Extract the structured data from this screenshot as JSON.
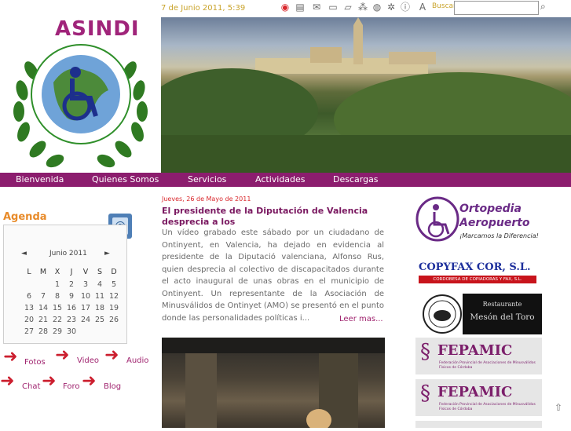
{
  "header": {
    "logo_text": "ASINDI",
    "logo_ring_text": "Asociación Integradora de Discapacitados",
    "date": "7 de Junio 2011, 5:39",
    "search_label": "Buscar",
    "search_value": ""
  },
  "nav": {
    "items": [
      {
        "label": "Bienvenida"
      },
      {
        "label": "Quienes Somos"
      },
      {
        "label": "Servicios"
      },
      {
        "label": "Actividades"
      },
      {
        "label": "Descargas"
      }
    ]
  },
  "agenda": {
    "title": "Agenda",
    "month": "Junio 2011",
    "prev": "◄",
    "next": "►",
    "weekdays": [
      "L",
      "M",
      "X",
      "J",
      "V",
      "S",
      "D"
    ],
    "weeks": [
      [
        "",
        "",
        "1",
        "2",
        "3",
        "4",
        "5"
      ],
      [
        "6",
        "7",
        "8",
        "9",
        "10",
        "11",
        "12"
      ],
      [
        "13",
        "14",
        "15",
        "16",
        "17",
        "18",
        "19"
      ],
      [
        "20",
        "21",
        "22",
        "23",
        "24",
        "25",
        "26"
      ],
      [
        "27",
        "28",
        "29",
        "30",
        "",
        "",
        ""
      ]
    ]
  },
  "links": {
    "fotos": "Fotos",
    "video": "Video",
    "audio": "Audio",
    "chat": "Chat",
    "foro": "Foro",
    "blog": "Blog"
  },
  "article": {
    "date": "Jueves, 26 de Mayo de 2011",
    "title": "El presidente de la Diputación de Valencia desprecia a los",
    "body": "Un vídeo grabado este sábado por un ciudadano de Ontinyent, en Valencia, ha dejado en evidencia al presidente de la Diputació valenciana, Alfonso Rus, quien desprecia al colectivo de discapacitados durante el acto inaugural de unas obras en el municipio de Ontinyent. Un representante de la Asociación de Minusválidos de Ontinyet (AMO)  se presentó en el punto donde las personalidades políticas i...",
    "read_more": "Leer mas..."
  },
  "ads": {
    "ortopedia_line1": "Ortopedia",
    "ortopedia_line2": "Aeropuerto",
    "ortopedia_tag": "¡Marcamos la Diferencia!",
    "copyfax_name": "COPYFAX COR, S.L.",
    "copyfax_sub": "CORDOBESA DE COPIADORAS Y FAX, S.L.",
    "meson_line1": "Restaurante",
    "meson_line2": "Mesón del Toro",
    "fepamic_name": "FEPAMIC",
    "fepamic_sub": "Federación Provincial de Asociaciones de Minusválidos Físicos de Córdoba"
  },
  "colors": {
    "nav_bg": "#8c1d6e",
    "accent_orange": "#e88b2a",
    "article_title": "#7a1860",
    "date_red": "#d9262b",
    "fepamic_purple": "#7c1f6b"
  }
}
